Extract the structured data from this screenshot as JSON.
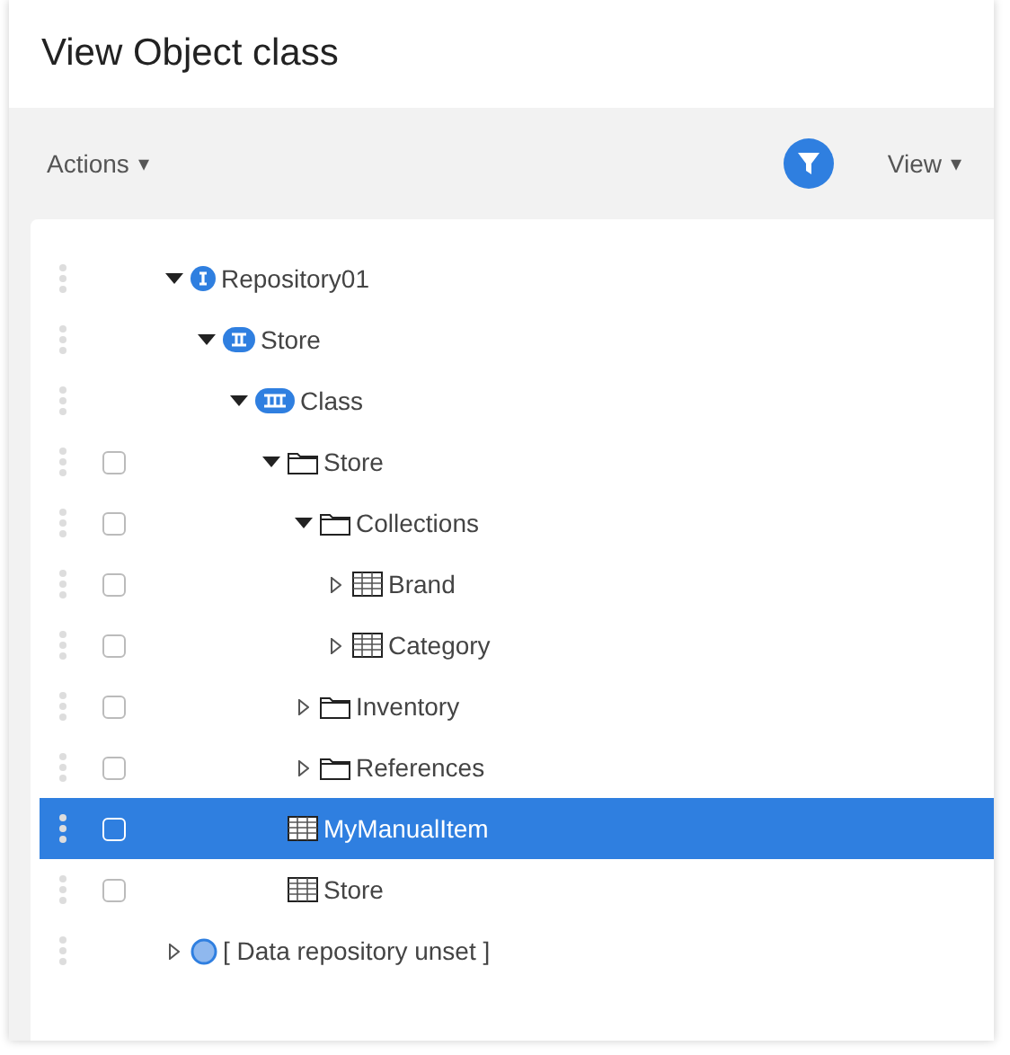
{
  "title": "View Object class",
  "toolbar": {
    "actions": {
      "label": "Actions",
      "caret": "▾"
    },
    "view": {
      "label": "View",
      "caret": "▾"
    },
    "filter_active": true
  },
  "tree": [
    {
      "label": "Repository01",
      "kind": "level1",
      "expandable": true,
      "expanded": true,
      "checkable": false,
      "selected": false,
      "children": [
        {
          "label": "Store",
          "kind": "level2",
          "expandable": true,
          "expanded": true,
          "checkable": false,
          "selected": false,
          "children": [
            {
              "label": "Class",
              "kind": "level3",
              "expandable": true,
              "expanded": true,
              "checkable": false,
              "selected": false,
              "children": [
                {
                  "label": "Store",
                  "kind": "folder",
                  "expandable": true,
                  "expanded": true,
                  "checkable": true,
                  "checked": false,
                  "selected": false,
                  "children": [
                    {
                      "label": "Collections",
                      "kind": "folder",
                      "expandable": true,
                      "expanded": true,
                      "checkable": true,
                      "checked": false,
                      "selected": false,
                      "children": [
                        {
                          "label": "Brand",
                          "kind": "table",
                          "expandable": true,
                          "expanded": false,
                          "checkable": true,
                          "checked": false,
                          "selected": false
                        },
                        {
                          "label": "Category",
                          "kind": "table",
                          "expandable": true,
                          "expanded": false,
                          "checkable": true,
                          "checked": false,
                          "selected": false
                        }
                      ]
                    },
                    {
                      "label": "Inventory",
                      "kind": "folder",
                      "expandable": true,
                      "expanded": false,
                      "checkable": true,
                      "checked": false,
                      "selected": false
                    },
                    {
                      "label": "References",
                      "kind": "folder",
                      "expandable": true,
                      "expanded": false,
                      "checkable": true,
                      "checked": false,
                      "selected": false
                    }
                  ]
                },
                {
                  "label": "MyManualItem",
                  "kind": "table",
                  "expandable": false,
                  "checkable": true,
                  "checked": false,
                  "selected": true
                },
                {
                  "label": "Store",
                  "kind": "table",
                  "expandable": false,
                  "checkable": true,
                  "checked": false,
                  "selected": false
                }
              ]
            }
          ]
        }
      ]
    },
    {
      "label": "[ Data repository unset ]",
      "kind": "dot",
      "expandable": true,
      "expanded": false,
      "checkable": false,
      "selected": false
    }
  ]
}
